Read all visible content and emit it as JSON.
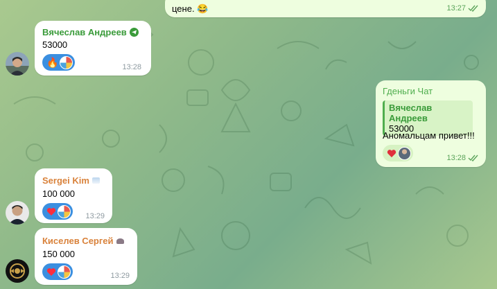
{
  "colors": {
    "name_green": "#3a9b3a",
    "name_orange": "#d9823b",
    "reaction_blue": "#3b8fe0",
    "out_bubble": "#eefedf"
  },
  "messages": [
    {
      "text": "цене. 😂",
      "time": "13:27",
      "read": true
    },
    {
      "sender": "Вячеслав Андреев",
      "text": "53000",
      "time": "13:28",
      "badge_icon": "telegram-badge-icon",
      "reactions": [
        "fire",
        "colorful-avatar"
      ]
    },
    {
      "sender": "Гденьги Чат",
      "reply_to_name": "Вячеслав Андреев",
      "reply_to_text": "53000",
      "text": "Аномальцам привет!!!",
      "time": "13:28",
      "read": true,
      "reactions": [
        "heart",
        "user-avatar"
      ]
    },
    {
      "sender": "Sergei Kim",
      "text": "100 000",
      "time": "13:29",
      "badge_icon": "cloud-badge-icon",
      "reactions": [
        "heart",
        "colorful-avatar"
      ]
    },
    {
      "sender": "Киселев Сергей",
      "text": "150 000",
      "time": "13:29",
      "badge_icon": "bird-badge-icon",
      "reactions": [
        "heart",
        "colorful-avatar"
      ]
    }
  ]
}
